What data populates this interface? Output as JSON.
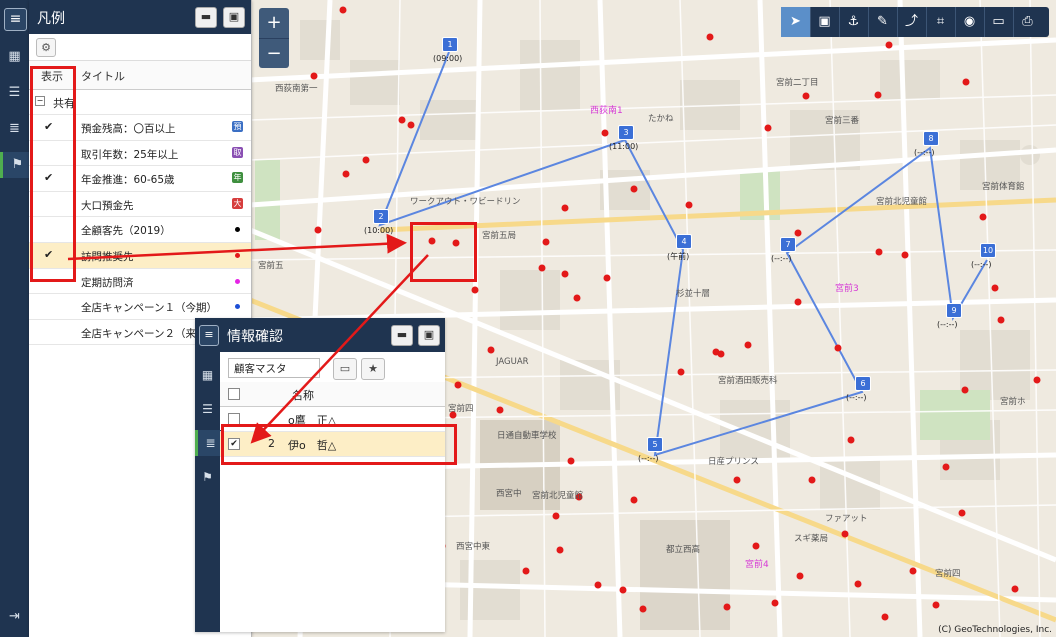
{
  "legend_panel": {
    "title": "凡例",
    "min_icon": "minimize-icon",
    "max_icon": "maximize-icon",
    "col_show": "表示",
    "col_title": "タイトル",
    "group_label": "共有",
    "items": [
      {
        "checked": "✔",
        "label": "預金残高：〇百以上",
        "symbol": "預",
        "color": "#3b6fc4"
      },
      {
        "checked": "",
        "label": "取引年数：25年以上",
        "symbol": "取",
        "color": "#8a4fb3"
      },
      {
        "checked": "✔",
        "label": "年金推進：60-65歳",
        "symbol": "年",
        "color": "#3f8f3f"
      },
      {
        "checked": "",
        "label": "大口預金先",
        "symbol": "大",
        "color": "#d63d3d"
      },
      {
        "checked": "",
        "label": "全顧客先（2019）",
        "dot": "#000000"
      },
      {
        "checked": "✔",
        "label": "訪問推奨先",
        "dot": "#e31919"
      },
      {
        "checked": "",
        "label": "定期訪問済",
        "dot": "#e524e5"
      },
      {
        "checked": "",
        "label": "全店キャンペーン１（今期）",
        "dot": "#1d4fd6"
      },
      {
        "checked": "",
        "label": "全店キャンペーン２（来期）",
        "dot": "#1d4fd6"
      }
    ]
  },
  "info_panel": {
    "title": "情報確認",
    "layer_select": "顧客マスタ",
    "col_name": "名称",
    "rows": [
      {
        "checked": "",
        "num": "",
        "name": "o鷹　正△"
      },
      {
        "checked": "✔",
        "num": "2",
        "name": "伊o　哲△"
      }
    ]
  },
  "toolbar": {
    "icons": [
      "pointer-icon",
      "select-area-icon",
      "anchor-icon",
      "edit-icon",
      "route-icon",
      "crop-icon",
      "measure-icon",
      "display-icon",
      "print-icon"
    ]
  },
  "zoom": {
    "plus": "+",
    "minus": "−"
  },
  "route_markers": [
    {
      "n": "1",
      "time": "(09:00)"
    },
    {
      "n": "2",
      "time": "(10:00)"
    },
    {
      "n": "3",
      "time": "(11:00)"
    },
    {
      "n": "4",
      "time": "(午前)"
    },
    {
      "n": "5",
      "time": "(--:--)"
    },
    {
      "n": "6",
      "time": "(--:--)"
    },
    {
      "n": "7",
      "time": "(--:--)"
    },
    {
      "n": "8",
      "time": "(--:--)"
    },
    {
      "n": "9",
      "time": "(--:--)"
    },
    {
      "n": "10",
      "time": "(--:--)"
    }
  ],
  "map_labels": {
    "area1": "西荻南1",
    "area2": "宮前3",
    "area3": "宮前4",
    "jaguar": "JAGUAR",
    "school": "日通自動車学校",
    "copyright": "(C) GeoTechnologies, Inc."
  }
}
